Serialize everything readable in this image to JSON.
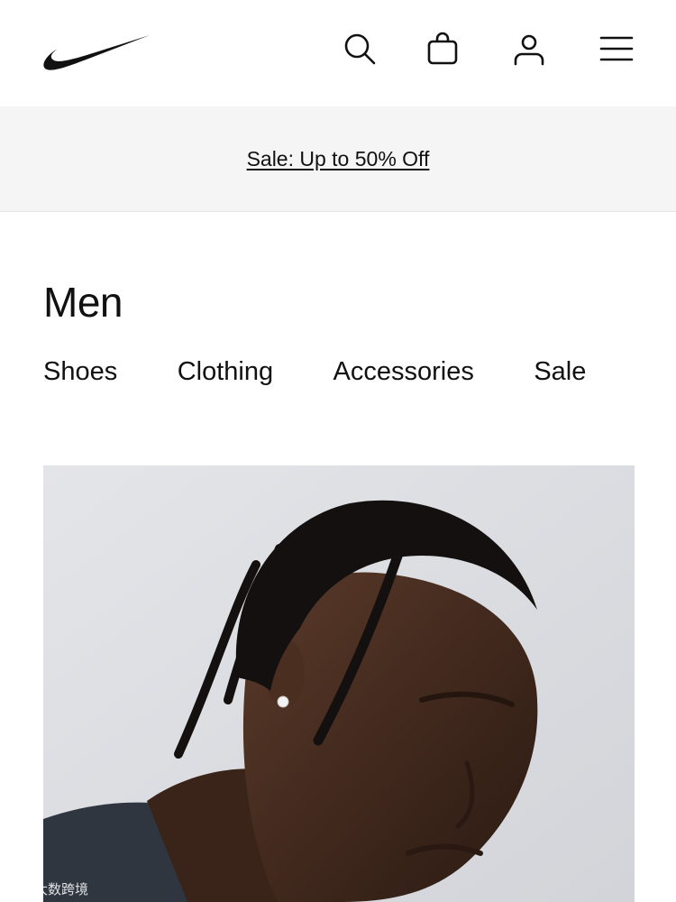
{
  "header": {
    "logo": "nike-swoosh",
    "icons": [
      "search-icon",
      "bag-icon",
      "account-icon",
      "menu-icon"
    ]
  },
  "promo": {
    "text": "Sale: Up to 50% Off"
  },
  "page": {
    "title": "Men"
  },
  "categories": [
    "Shoes",
    "Clothing",
    "Accessories",
    "Sale"
  ],
  "watermark": {
    "text": "大数跨境"
  },
  "colors": {
    "text": "#111111",
    "banner_bg": "#f5f5f5",
    "hero_bg": "#dcdde0"
  }
}
